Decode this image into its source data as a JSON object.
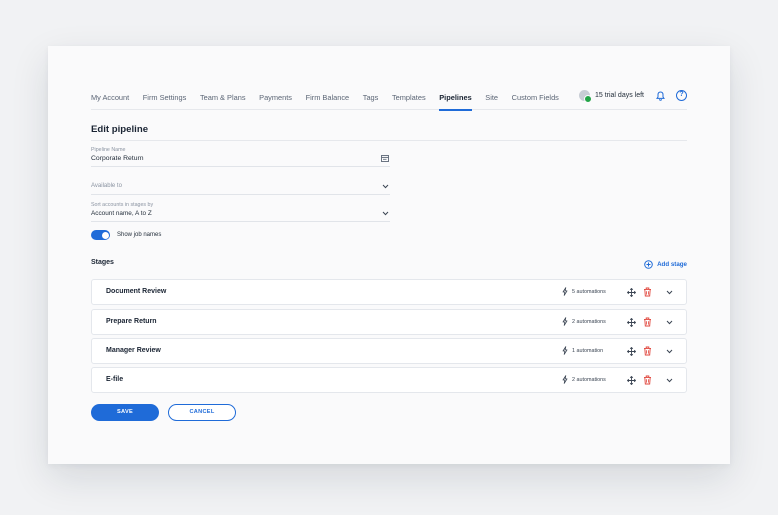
{
  "nav": {
    "tabs": [
      {
        "label": "My Account"
      },
      {
        "label": "Firm Settings"
      },
      {
        "label": "Team & Plans"
      },
      {
        "label": "Payments"
      },
      {
        "label": "Firm Balance"
      },
      {
        "label": "Tags"
      },
      {
        "label": "Templates"
      },
      {
        "label": "Pipelines",
        "active": true
      },
      {
        "label": "Site"
      },
      {
        "label": "Custom Fields"
      }
    ],
    "trial_text": "15 trial days left",
    "help_glyph": "?",
    "icons": [
      "trial-status-icon",
      "bell-icon",
      "help-icon"
    ]
  },
  "page": {
    "title": "Edit pipeline"
  },
  "form": {
    "pipeline_name": {
      "label": "Pipeline Name",
      "value": "Corporate Return",
      "icon": "template-icon"
    },
    "available_to": {
      "placeholder": "Available to",
      "icon": "chevron-down-icon"
    },
    "sort_accounts": {
      "label": "Sort accounts in stages by",
      "value": "Account name, A to Z",
      "icon": "chevron-down-icon"
    },
    "show_job_names": {
      "label": "Show job names",
      "enabled": true
    }
  },
  "stages": {
    "title": "Stages",
    "add_label": "Add stage",
    "items": [
      {
        "name": "Document Review",
        "automations": "5 automations"
      },
      {
        "name": "Prepare Return",
        "automations": "2 automations"
      },
      {
        "name": "Manager Review",
        "automations": "1 automation"
      },
      {
        "name": "E-file",
        "automations": "2 automations"
      }
    ]
  },
  "buttons": {
    "save_label": "SAVE",
    "cancel_label": "CANCEL"
  },
  "colors": {
    "accent": "#1f6bd8",
    "danger": "#e0443b",
    "success": "#22a447"
  }
}
